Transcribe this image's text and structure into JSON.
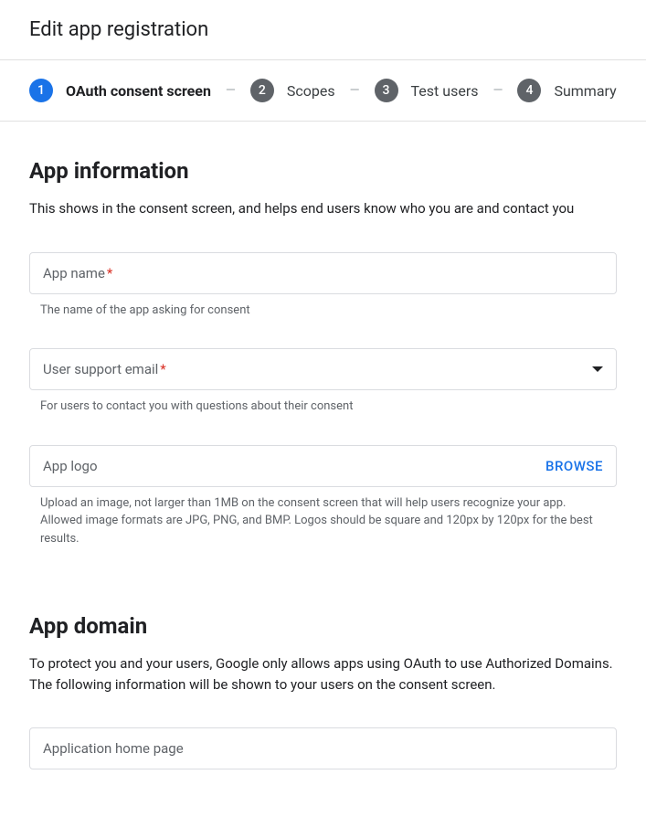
{
  "page": {
    "title": "Edit app registration"
  },
  "stepper": {
    "steps": [
      {
        "num": "1",
        "label": "OAuth consent screen",
        "active": true
      },
      {
        "num": "2",
        "label": "Scopes",
        "active": false
      },
      {
        "num": "3",
        "label": "Test users",
        "active": false
      },
      {
        "num": "4",
        "label": "Summary",
        "active": false
      }
    ]
  },
  "appInfo": {
    "heading": "App information",
    "desc": "This shows in the consent screen, and helps end users know who you are and contact you",
    "appName": {
      "label": "App name",
      "required": "*",
      "helper": "The name of the app asking for consent"
    },
    "supportEmail": {
      "label": "User support email",
      "required": "*",
      "helper": "For users to contact you with questions about their consent"
    },
    "appLogo": {
      "label": "App logo",
      "browse": "BROWSE",
      "helper": "Upload an image, not larger than 1MB on the consent screen that will help users recognize your app. Allowed image formats are JPG, PNG, and BMP. Logos should be square and 120px by 120px for the best results."
    }
  },
  "appDomain": {
    "heading": "App domain",
    "desc": "To protect you and your users, Google only allows apps using OAuth to use Authorized Domains. The following information will be shown to your users on the consent screen.",
    "homePage": {
      "label": "Application home page"
    }
  }
}
